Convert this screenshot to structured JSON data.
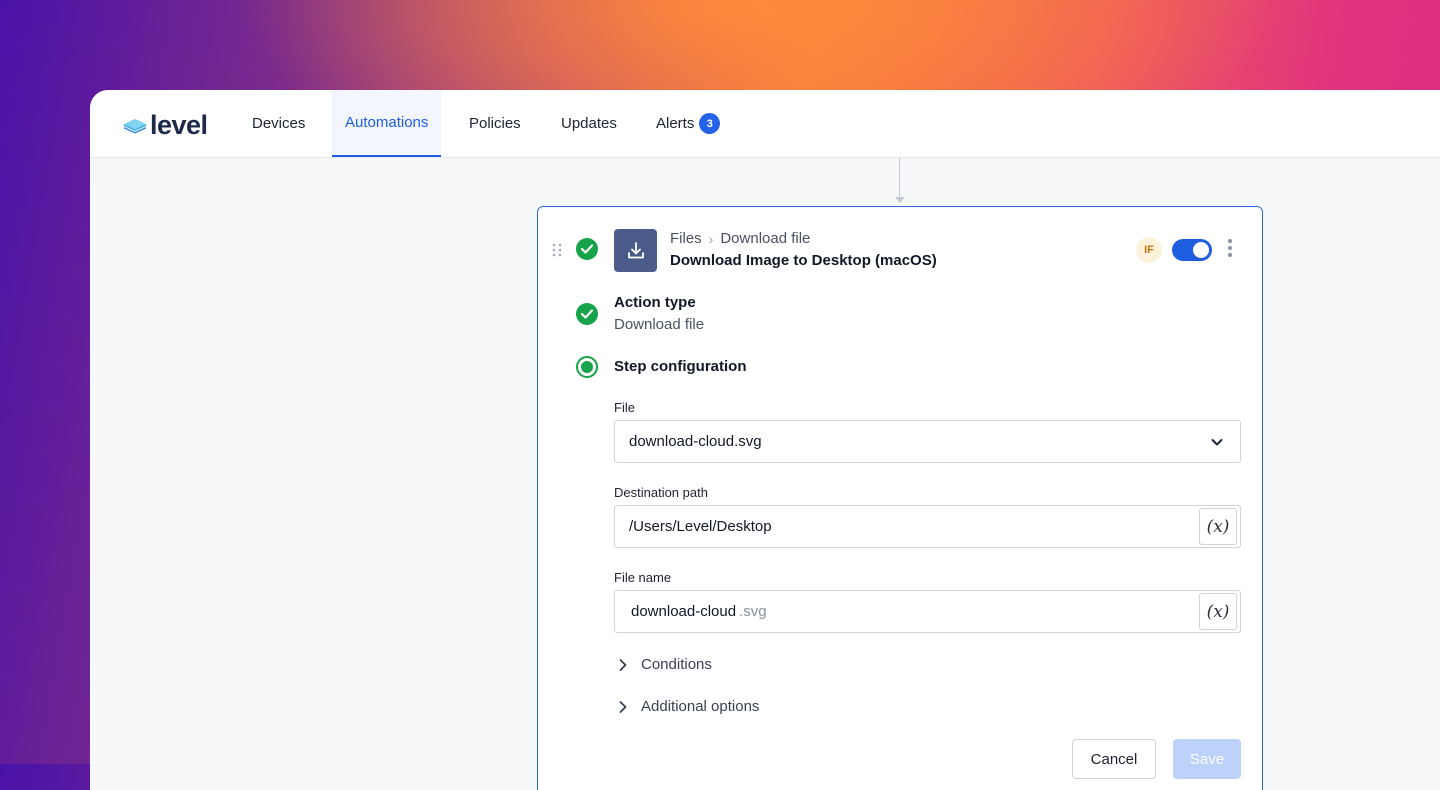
{
  "brand": {
    "name": "level"
  },
  "nav": {
    "devices": "Devices",
    "automations": "Automations",
    "policies": "Policies",
    "updates": "Updates",
    "alerts": "Alerts",
    "alerts_count": "3"
  },
  "step": {
    "breadcrumb_parent": "Files",
    "breadcrumb_child": "Download file",
    "title": "Download Image to Desktop (macOS)",
    "if_badge": "IF",
    "enabled": true,
    "icon": "download-icon"
  },
  "action_type": {
    "label": "Action type",
    "value": "Download file"
  },
  "config": {
    "label": "Step configuration",
    "file_label": "File",
    "file_value": "download-cloud.svg",
    "destination_label": "Destination path",
    "destination_value": "/Users/Level/Desktop",
    "filename_label": "File name",
    "filename_base": "download-cloud",
    "filename_ext": ".svg",
    "variable_button": "(x)"
  },
  "sections": {
    "conditions": "Conditions",
    "additional": "Additional options"
  },
  "buttons": {
    "cancel": "Cancel",
    "save": "Save"
  },
  "colors": {
    "accent": "#1f5ee0",
    "success": "#16a34a",
    "if_badge_bg": "#fdf3dc"
  }
}
